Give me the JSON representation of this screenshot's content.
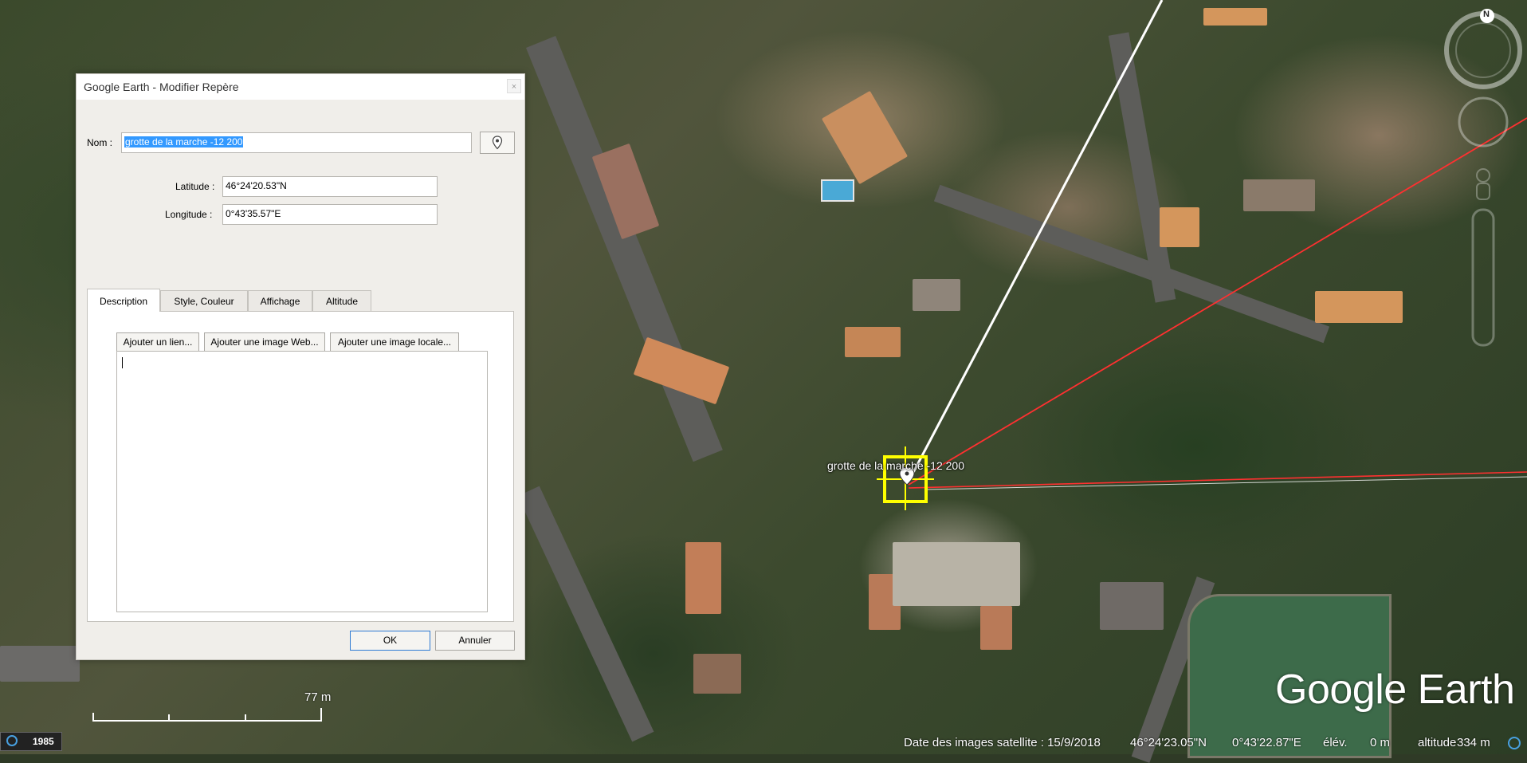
{
  "dialog": {
    "title": "Google Earth - Modifier Repère",
    "close_label": "×",
    "name_label": "Nom :",
    "name_value": "grotte de la marche -12 200",
    "latitude_label": "Latitude :",
    "latitude_value": "46°24'20.53\"N",
    "longitude_label": "Longitude :",
    "longitude_value": "0°43'35.57\"E",
    "tabs": [
      {
        "label": "Description",
        "active": true
      },
      {
        "label": "Style, Couleur",
        "active": false
      },
      {
        "label": "Affichage",
        "active": false
      },
      {
        "label": "Altitude",
        "active": false
      }
    ],
    "buttons": {
      "add_link": "Ajouter un lien...",
      "add_web_image": "Ajouter une image Web...",
      "add_local_image": "Ajouter une image locale...",
      "ok": "OK",
      "cancel": "Annuler"
    },
    "description_value": ""
  },
  "map": {
    "placemark_label": "grotte de la marche -12 200",
    "scale_label": "77  m",
    "imagery_year": "1985",
    "compass_north": "N",
    "logo": "Google Earth",
    "status": {
      "imagery_date": "Date des images satellite : 15/9/2018",
      "lat": "46°24'23.05\"N",
      "lon": "0°43'22.87\"E",
      "elev_label": "élév.",
      "elev_value": "0 m",
      "altitude_label": "altitude",
      "altitude_value": "334 m"
    },
    "colors": {
      "placemark_box": "#ffff00",
      "path_white": "#ffffff",
      "path_red": "#ff3030"
    }
  }
}
